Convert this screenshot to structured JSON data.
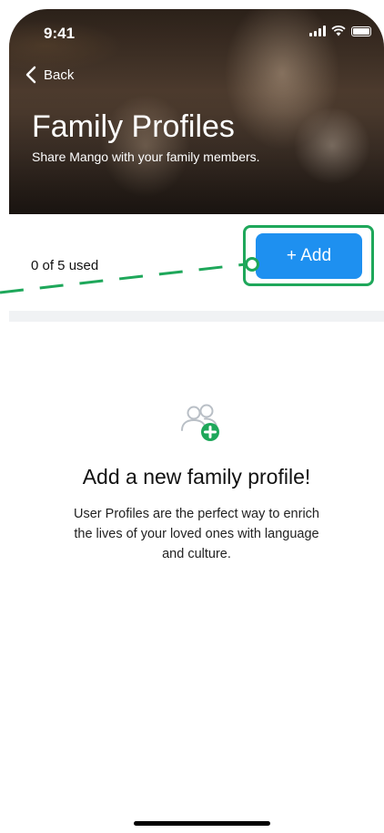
{
  "status_bar": {
    "time": "9:41"
  },
  "header": {
    "back_label": "Back",
    "title": "Family Profiles",
    "subtitle": "Share Mango with your family members."
  },
  "usage": {
    "text": "0 of 5 used",
    "used": 0,
    "total": 5
  },
  "add_button": {
    "label": "+ Add"
  },
  "empty_state": {
    "icon": "add-user-group-icon",
    "title": "Add a new family profile!",
    "body": "User Profiles are the perfect way to enrich the lives of your loved ones with language and culture."
  },
  "colors": {
    "accent": "#1e90f0",
    "highlight": "#1ea75a"
  }
}
